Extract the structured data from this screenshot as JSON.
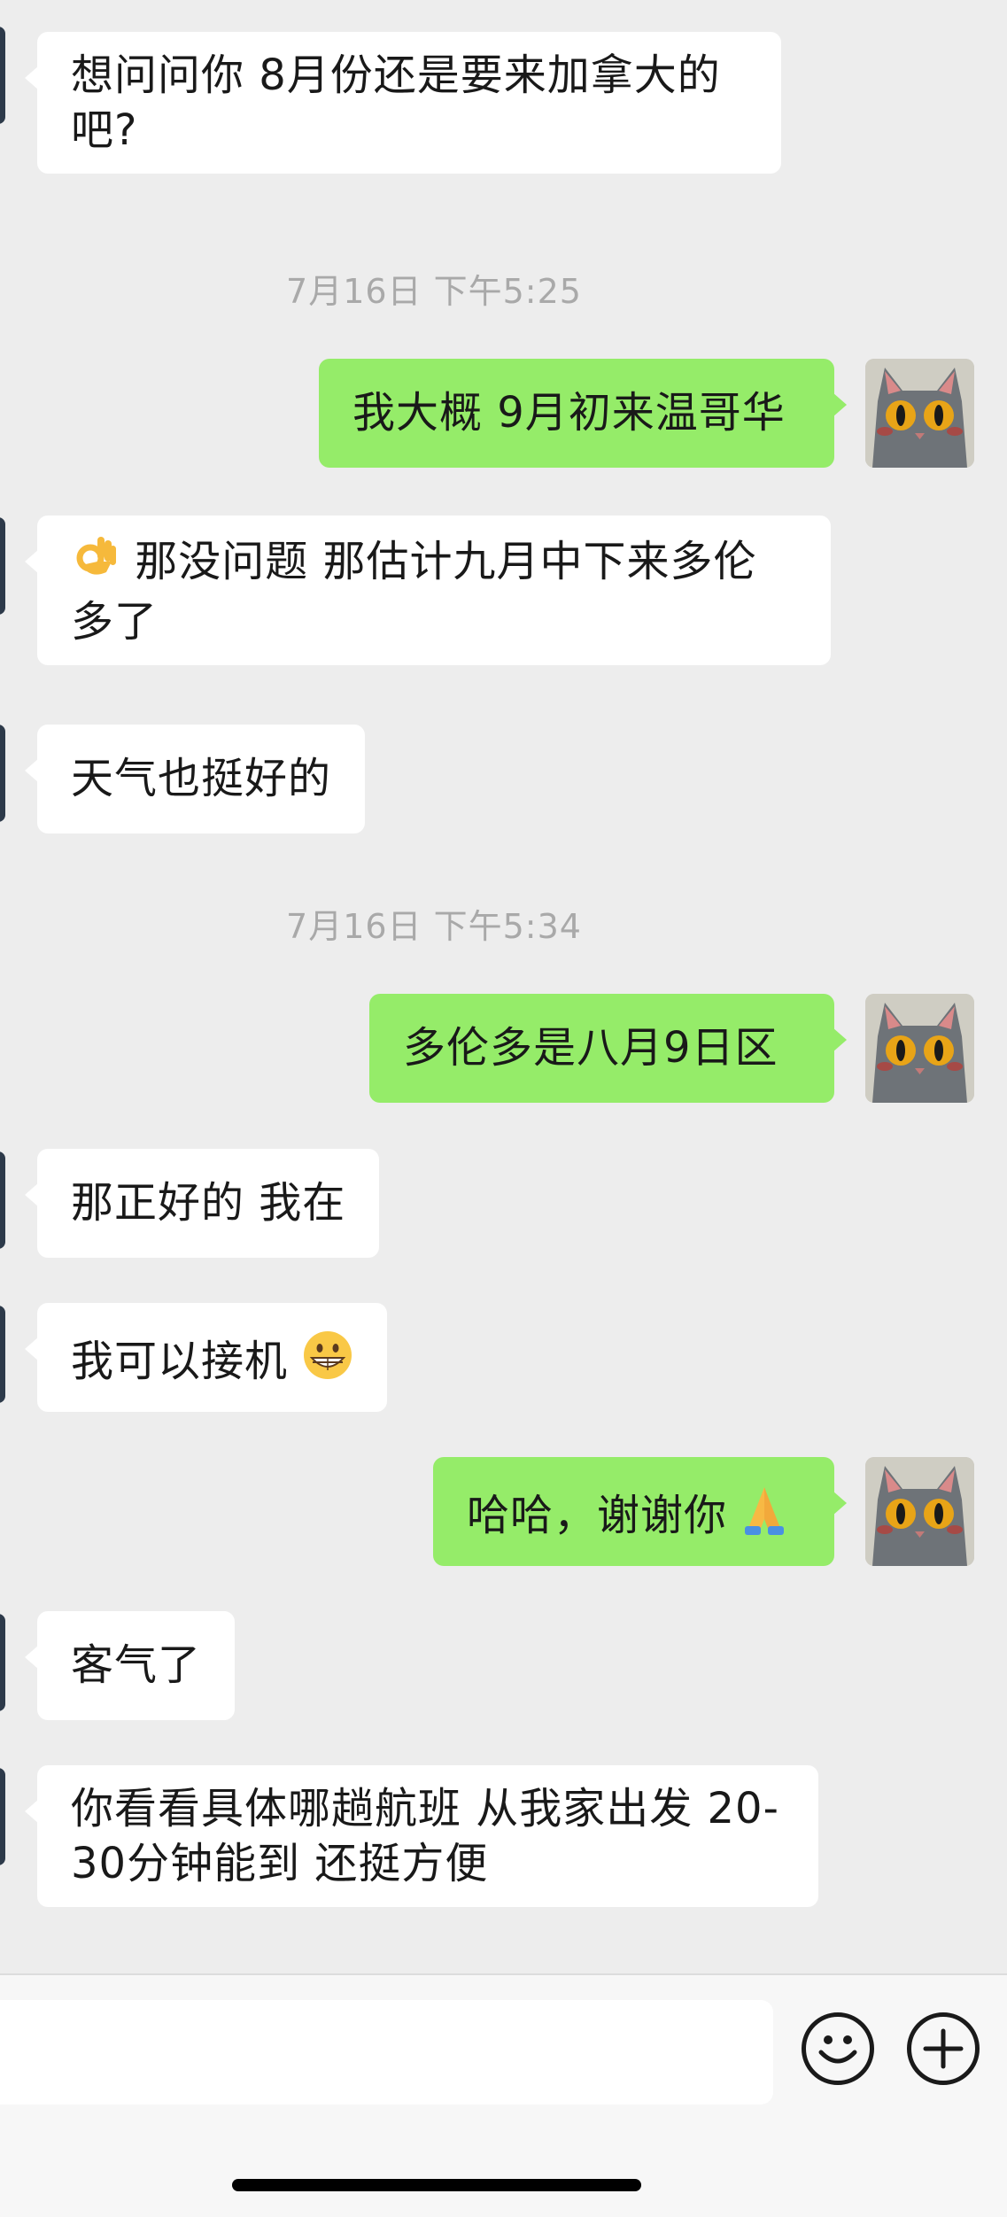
{
  "colors": {
    "background": "#ededed",
    "incoming_bubble": "#ffffff",
    "outgoing_bubble": "#95ec69",
    "timestamp_text": "#a9a9a9"
  },
  "messages": [
    {
      "side": "in",
      "text": "想问问你 8月份还是要来加拿大的吧?"
    },
    {
      "type": "timestamp",
      "text": "7月16日 下午5:25"
    },
    {
      "side": "out",
      "text": "我大概 9月初来温哥华"
    },
    {
      "side": "in",
      "emoji": "ok-hand",
      "text": "那没问题 那估计九月中下来多伦多了"
    },
    {
      "side": "in",
      "text": "天气也挺好的"
    },
    {
      "type": "timestamp",
      "text": "7月16日 下午5:34"
    },
    {
      "side": "out",
      "text": "多伦多是八月9日区"
    },
    {
      "side": "in",
      "text": "那正好的 我在"
    },
    {
      "side": "in",
      "text": "我可以接机",
      "emoji": "grinning-face"
    },
    {
      "side": "out",
      "text": "哈哈，谢谢你",
      "emoji": "folded-hands"
    },
    {
      "side": "in",
      "text": "客气了"
    },
    {
      "side": "in",
      "text": "你看看具体哪趟航班 从我家出发 20-30分钟能到 还挺方便"
    }
  ],
  "input_bar": {
    "text_value": "",
    "emoji_button_icon": "smiley-face-icon",
    "more_button_icon": "plus-circle-icon"
  }
}
